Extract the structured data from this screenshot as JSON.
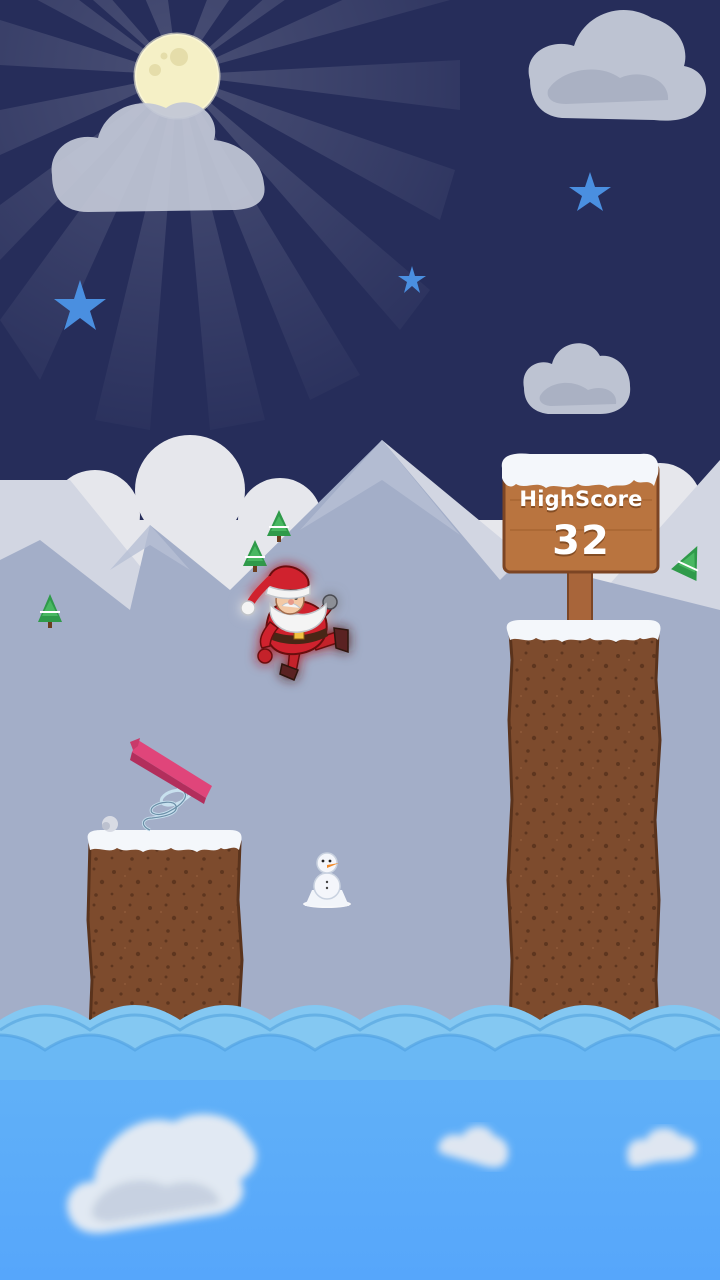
{
  "hud": {
    "highscore_label": "HighScore",
    "highscore_value": "32"
  },
  "colors": {
    "night_sky": "#262d5a",
    "mountains": "#a3aec8",
    "water": "#5aaaf5",
    "dirt": "#7b4a2c",
    "sign_wood": "#b9743f",
    "spring_board": "#e0457a",
    "star": "#4a8fe0"
  },
  "sprites": {
    "player": "santa-claus",
    "obstacle": "snowman",
    "launcher": "spring-board"
  }
}
